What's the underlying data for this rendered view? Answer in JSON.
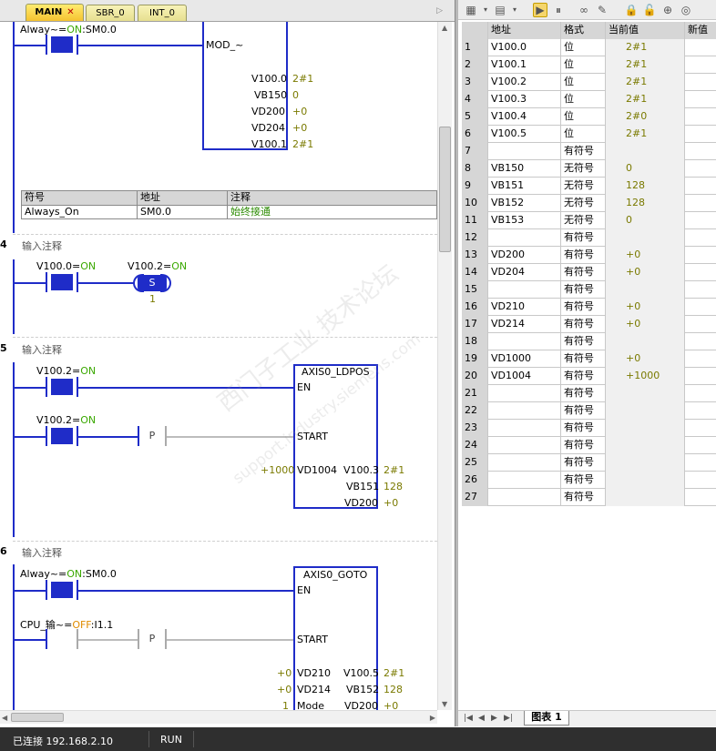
{
  "tabs": [
    {
      "label": "MAIN",
      "close": "✕"
    },
    {
      "label": "SBR_0"
    },
    {
      "label": "INT_0"
    }
  ],
  "network1": {
    "contact_addr": "Alway~",
    "contact_state": "ON",
    "contact_suffix": ":SM0.0",
    "block_title": "MOD_~",
    "outputs": [
      {
        "addr": "V100.0",
        "val": "2#1"
      },
      {
        "addr": "VB150",
        "val": "0"
      },
      {
        "addr": "VD200",
        "val": "+0"
      },
      {
        "addr": "VD204",
        "val": "+0"
      },
      {
        "addr": "V100.1",
        "val": "2#1"
      }
    ],
    "symtable": {
      "headers": [
        "符号",
        "地址",
        "注释"
      ],
      "rows": [
        [
          "Always_On",
          "SM0.0",
          "始终接通"
        ]
      ]
    }
  },
  "network4": {
    "num": "4",
    "comment": "输入注释",
    "contact_addr": "V100.0=",
    "contact_state": "ON",
    "coil_addr": "V100.2=",
    "coil_state": "ON",
    "coil_label": "S",
    "coil_count": "1"
  },
  "network5": {
    "num": "5",
    "comment": "输入注释",
    "c1_addr": "V100.2=",
    "c1_state": "ON",
    "c2_addr": "V100.2=",
    "c2_state": "ON",
    "p_label": "P",
    "block_title": "AXIS0_LDPOS",
    "pin_en": "EN",
    "pin_start": "START",
    "in_val": "+1000",
    "in_pin": "VD1004",
    "outputs": [
      {
        "addr": "V100.3",
        "val": "2#1"
      },
      {
        "addr": "VB151",
        "val": "128"
      },
      {
        "addr": "VD200",
        "val": "+0"
      }
    ]
  },
  "network6": {
    "num": "6",
    "comment": "输入注释",
    "c1_addr": "Alway~=",
    "c1_state": "ON",
    "c1_suffix": ":SM0.0",
    "c2_addr": "CPU_输~=",
    "c2_state": "OFF",
    "c2_suffix": ":I1.1",
    "p_label": "P",
    "block_title": "AXIS0_GOTO",
    "pin_en": "EN",
    "pin_start": "START",
    "inputs": [
      {
        "val": "+0",
        "pin": "VD210"
      },
      {
        "val": "+0",
        "pin": "VD214"
      },
      {
        "val": "1",
        "pin": "Mode"
      }
    ],
    "outputs": [
      {
        "addr": "V100.5",
        "val": "2#1"
      },
      {
        "addr": "VB152",
        "val": "128"
      },
      {
        "addr": "VD200",
        "val": "+0"
      }
    ]
  },
  "table": {
    "headers": [
      "",
      "地址",
      "格式",
      "当前值",
      "新值"
    ],
    "rows": [
      [
        "1",
        "V100.0",
        "位",
        "2#1",
        ""
      ],
      [
        "2",
        "V100.1",
        "位",
        "2#1",
        ""
      ],
      [
        "3",
        "V100.2",
        "位",
        "2#1",
        ""
      ],
      [
        "4",
        "V100.3",
        "位",
        "2#1",
        ""
      ],
      [
        "5",
        "V100.4",
        "位",
        "2#0",
        ""
      ],
      [
        "6",
        "V100.5",
        "位",
        "2#1",
        ""
      ],
      [
        "7",
        "",
        "有符号",
        "",
        ""
      ],
      [
        "8",
        "VB150",
        "无符号",
        "0",
        ""
      ],
      [
        "9",
        "VB151",
        "无符号",
        "128",
        ""
      ],
      [
        "10",
        "VB152",
        "无符号",
        "128",
        ""
      ],
      [
        "11",
        "VB153",
        "无符号",
        "0",
        ""
      ],
      [
        "12",
        "",
        "有符号",
        "",
        ""
      ],
      [
        "13",
        "VD200",
        "有符号",
        "+0",
        ""
      ],
      [
        "14",
        "VD204",
        "有符号",
        "+0",
        ""
      ],
      [
        "15",
        "",
        "有符号",
        "",
        ""
      ],
      [
        "16",
        "VD210",
        "有符号",
        "+0",
        ""
      ],
      [
        "17",
        "VD214",
        "有符号",
        "+0",
        ""
      ],
      [
        "18",
        "",
        "有符号",
        "",
        ""
      ],
      [
        "19",
        "VD1000",
        "有符号",
        "+0",
        ""
      ],
      [
        "20",
        "VD1004",
        "有符号",
        "+1000",
        ""
      ],
      [
        "21",
        "",
        "有符号",
        "",
        ""
      ],
      [
        "22",
        "",
        "有符号",
        "",
        ""
      ],
      [
        "23",
        "",
        "有符号",
        "",
        ""
      ],
      [
        "24",
        "",
        "有符号",
        "",
        ""
      ],
      [
        "25",
        "",
        "有符号",
        "",
        ""
      ],
      [
        "26",
        "",
        "有符号",
        "",
        ""
      ],
      [
        "27",
        "",
        "有符号",
        "",
        ""
      ]
    ],
    "sheet_tab": "图表 1"
  },
  "status": {
    "connection": "已连接 192.168.2.10",
    "mode": "RUN"
  },
  "watermark": {
    "line1": "西门子工业 技术论坛",
    "line2": "support.industry.siemens.com"
  }
}
